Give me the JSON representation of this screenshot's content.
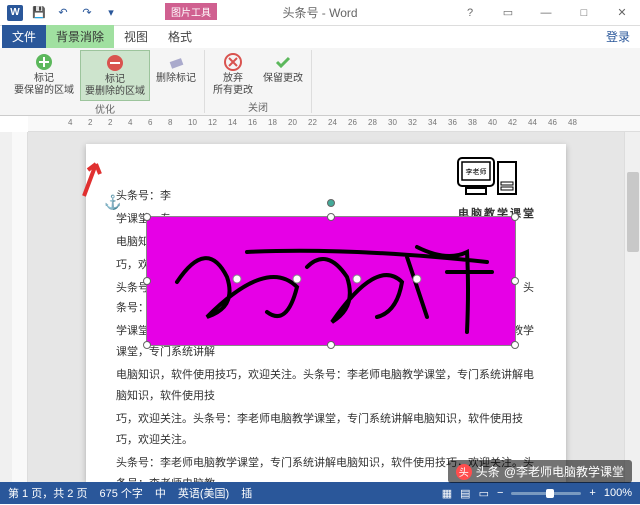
{
  "title": "头条号 - Word",
  "qat": {
    "save": "保存",
    "undo": "撤销",
    "redo": "重做"
  },
  "pic_tools_header": "图片工具",
  "tabs": {
    "file": "文件",
    "bg_remove": "背景消除",
    "view": "视图",
    "format": "格式",
    "login": "登录"
  },
  "ribbon": {
    "mark_keep": "标记\n要保留的区域",
    "mark_remove": "标记\n要删除的区域",
    "delete_mark": "删除标记",
    "discard": "放弃\n所有更改",
    "keep": "保留更改",
    "group_optimize": "优化",
    "group_close": "关闭"
  },
  "ruler_marks": [
    "4",
    "2",
    "2",
    "4",
    "6",
    "8",
    "10",
    "12",
    "14",
    "16",
    "18",
    "20",
    "22",
    "24",
    "26",
    "28",
    "30",
    "32",
    "34",
    "36",
    "38",
    "40",
    "42",
    "44",
    "46",
    "48"
  ],
  "logo": {
    "name": "李老师",
    "caption": "电脑教学课堂"
  },
  "body_paragraphs": [
    "头条号：李",
    "学课堂，专",
    "电脑知识，",
    "巧，欢迎关",
    "头条号：李老师电脑教学课堂，专门系统讲解电脑知识，软件使用技巧，欢迎关注。头条号：李老师电脑教",
    "学课堂，专门系统讲解电脑知识，软件使用技巧，欢迎关注。头条号：李老师电脑教学课堂，专门系统讲解",
    "电脑知识，软件使用技巧，欢迎关注。头条号：李老师电脑教学课堂，专门系统讲解电脑知识，软件使用技",
    "巧，欢迎关注。头条号：李老师电脑教学课堂，专门系统讲解电脑知识，软件使用技巧，欢迎关注。",
    "头条号：李老师电脑教学课堂，专门系统讲解电脑知识，软件使用技巧，欢迎关注。头条号：李老师电脑教"
  ],
  "status": {
    "page": "第 1 页，共 2 页",
    "words": "675 个字",
    "lang_icon": "中",
    "lang": "英语(美国)",
    "insert": "插",
    "zoom": "100%"
  },
  "watermark": {
    "icon": "头",
    "prefix": "头条",
    "text": "@李老师电脑教学课堂"
  }
}
